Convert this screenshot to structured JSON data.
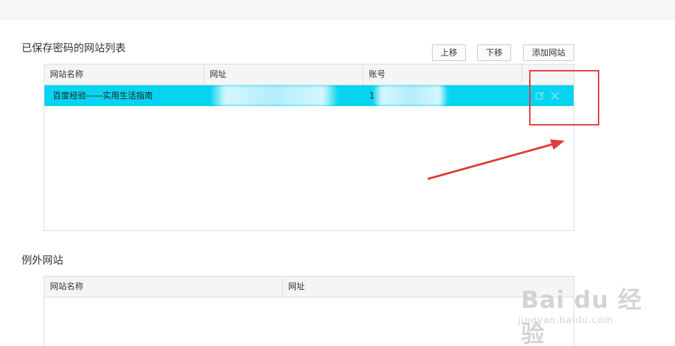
{
  "saved_section": {
    "title": "已保存密码的网站列表",
    "buttons": {
      "up": "上移",
      "down": "下移",
      "add": "添加网站"
    },
    "columns": [
      "网站名称",
      "网址",
      "账号"
    ],
    "rows": [
      {
        "name": "百度经验——实用生活指南",
        "url": "",
        "account": "1"
      }
    ]
  },
  "exception_section": {
    "title": "例外网站",
    "columns": [
      "网站名称",
      "网址"
    ]
  },
  "icons": {
    "edit": "edit-icon",
    "delete": "close-icon"
  },
  "colors": {
    "selected_row": "#05d4f0",
    "annotation": "#e23b3b"
  },
  "watermark": {
    "main": "Bai du 经验",
    "sub": "jingyan.baidu.com"
  }
}
